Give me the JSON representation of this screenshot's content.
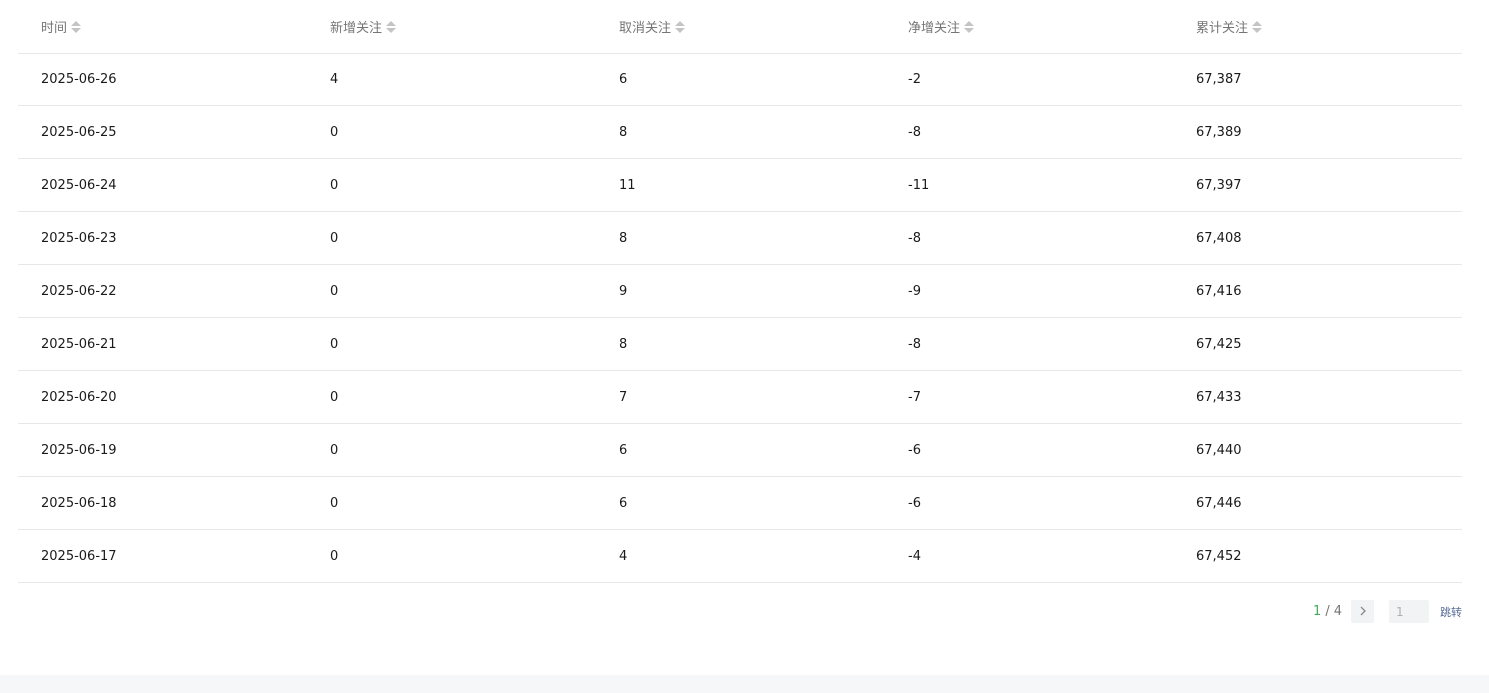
{
  "table": {
    "headers": [
      "时间",
      "新增关注",
      "取消关注",
      "净增关注",
      "累计关注"
    ],
    "rows": [
      [
        "2025-06-26",
        "4",
        "6",
        "-2",
        "67,387"
      ],
      [
        "2025-06-25",
        "0",
        "8",
        "-8",
        "67,389"
      ],
      [
        "2025-06-24",
        "0",
        "11",
        "-11",
        "67,397"
      ],
      [
        "2025-06-23",
        "0",
        "8",
        "-8",
        "67,408"
      ],
      [
        "2025-06-22",
        "0",
        "9",
        "-9",
        "67,416"
      ],
      [
        "2025-06-21",
        "0",
        "8",
        "-8",
        "67,425"
      ],
      [
        "2025-06-20",
        "0",
        "7",
        "-7",
        "67,433"
      ],
      [
        "2025-06-19",
        "0",
        "6",
        "-6",
        "67,440"
      ],
      [
        "2025-06-18",
        "0",
        "6",
        "-6",
        "67,446"
      ],
      [
        "2025-06-17",
        "0",
        "4",
        "-4",
        "67,452"
      ]
    ]
  },
  "pagination": {
    "current": "1",
    "separator": "/",
    "total": "4",
    "next_icon": "chevron-right-icon",
    "input_value": "1",
    "jump_label": "跳转"
  },
  "colors": {
    "accent_green": "#47a85a",
    "link_blue": "#576b95",
    "divider": "#e7e7e7"
  }
}
